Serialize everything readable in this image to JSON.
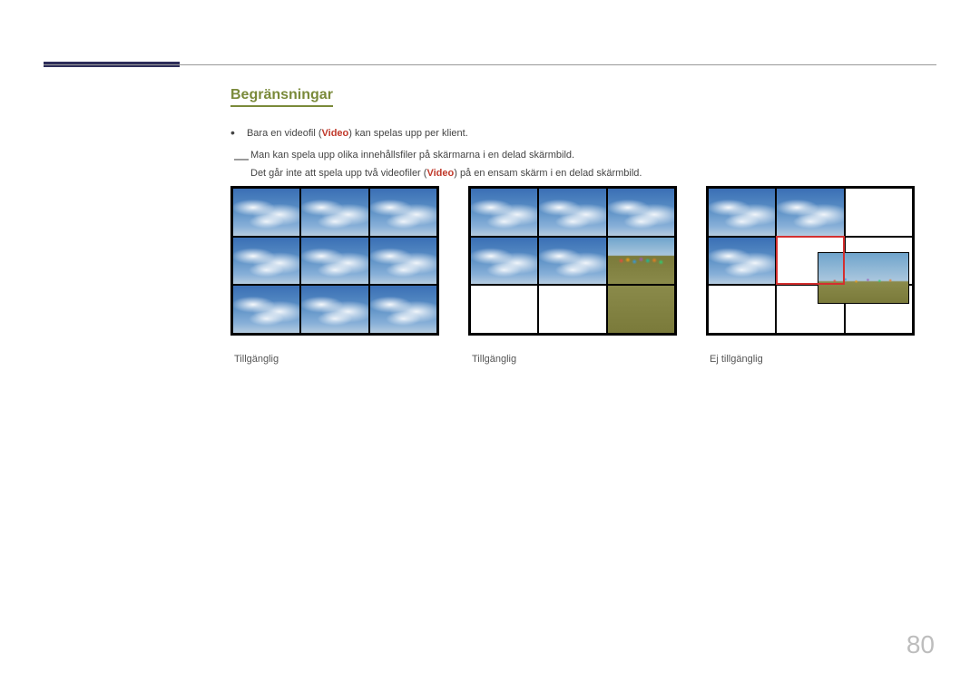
{
  "section_title": "Begränsningar",
  "bullet": {
    "pre": "Bara en videofil (",
    "video": "Video",
    "post": ") kan spelas upp per klient."
  },
  "sub_line1": "Man kan spela upp olika innehållsfiler på skärmarna i en delad skärmbild.",
  "sub_line2": {
    "pre": "Det går inte att spela upp två videofiler (",
    "video": "Video",
    "post": ") på en ensam skärm i en delad skärmbild."
  },
  "figures": [
    {
      "label": "Tillgänglig"
    },
    {
      "label": "Tillgänglig"
    },
    {
      "label": "Ej tillgänglig"
    }
  ],
  "page_number": "80"
}
